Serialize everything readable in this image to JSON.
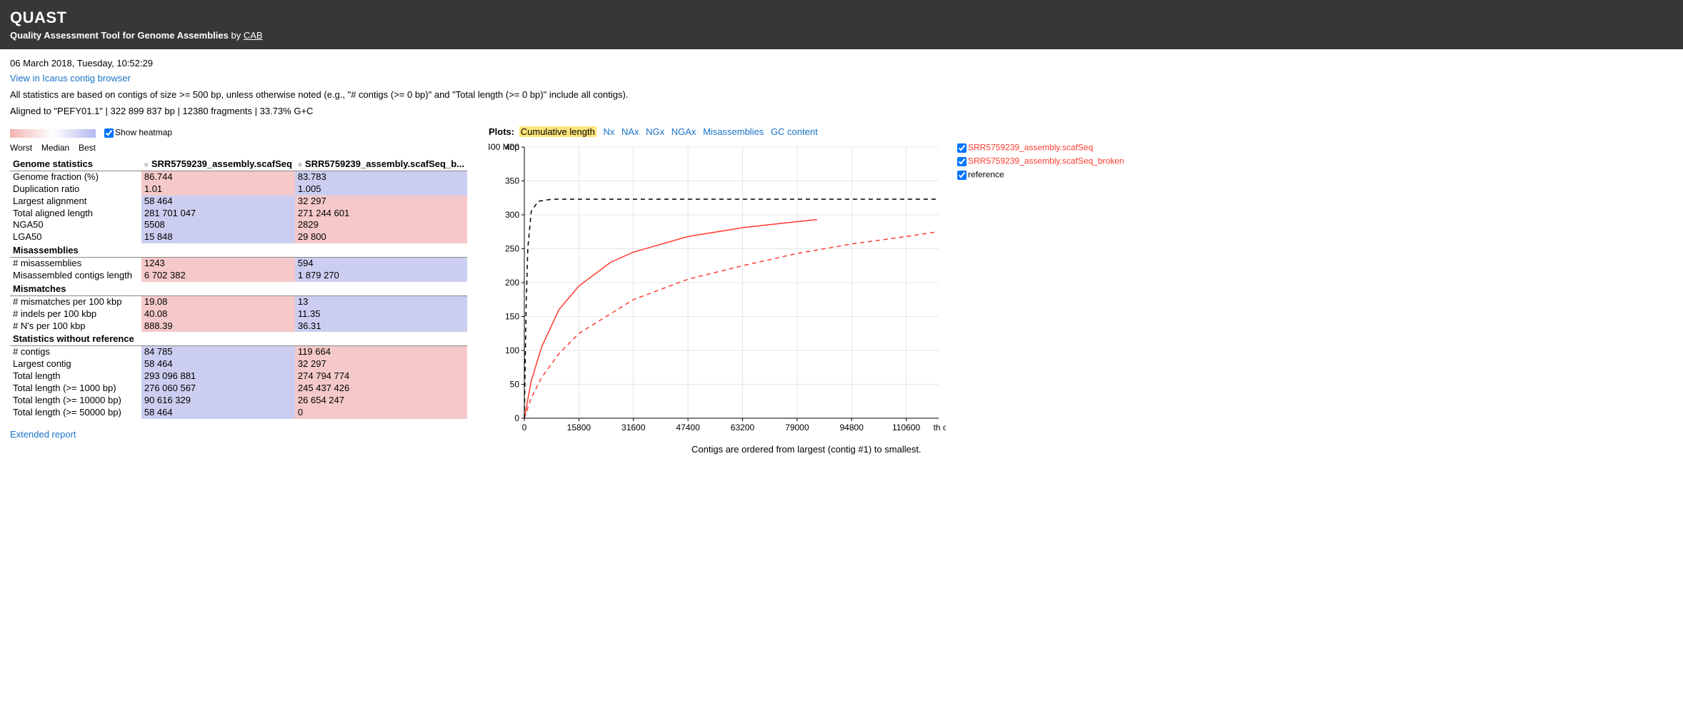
{
  "header": {
    "title": "QUAST",
    "subtitle_prefix": "Quality Assessment Tool for Genome Assemblies",
    "by": "by",
    "cab": "CAB"
  },
  "timestamp": "06 March 2018, Tuesday, 10:52:29",
  "icarus_link": "View in Icarus contig browser",
  "note": "All statistics are based on contigs of size >= 500 bp, unless otherwise noted (e.g., \"# contigs (>= 0 bp)\" and \"Total length (>= 0 bp)\" include all contigs).",
  "aligned": "Aligned to \"PEFY01.1\" | 322 899 837 bp | 12380 fragments | 33.73% G+C",
  "heatmap": {
    "worst": "Worst",
    "median": "Median",
    "best": "Best",
    "show": "Show heatmap"
  },
  "columns": {
    "c0": "Genome statistics",
    "c1": "SRR5759239_assembly.scafSeq",
    "c2": "SRR5759239_assembly.scafSeq_b..."
  },
  "sections": {
    "genome_stats": "Genome statistics",
    "misassemblies": "Misassemblies",
    "mismatches": "Mismatches",
    "no_ref": "Statistics without reference"
  },
  "rows": {
    "genome_fraction": {
      "label": "Genome fraction (%)",
      "v1": "86.744",
      "v2": "83.783",
      "hm1": "worst",
      "hm2": "best"
    },
    "dup_ratio": {
      "label": "Duplication ratio",
      "v1": "1.01",
      "v2": "1.005",
      "hm1": "worst",
      "hm2": "best"
    },
    "largest_alignment": {
      "label": "Largest alignment",
      "v1": "58 464",
      "v2": "32 297",
      "hm1": "best",
      "hm2": "worst"
    },
    "total_aligned": {
      "label": "Total aligned length",
      "v1": "281 701 047",
      "v2": "271 244 601",
      "hm1": "best",
      "hm2": "worst"
    },
    "nga50": {
      "label": "NGA50",
      "v1": "5508",
      "v2": "2829",
      "hm1": "best",
      "hm2": "worst"
    },
    "lga50": {
      "label": "LGA50",
      "v1": "15 848",
      "v2": "29 800",
      "hm1": "best",
      "hm2": "worst"
    },
    "n_misassemblies": {
      "label": "# misassemblies",
      "v1": "1243",
      "v2": "594",
      "hm1": "worst",
      "hm2": "best"
    },
    "misassembled_len": {
      "label": "Misassembled contigs length",
      "v1": "6 702 382",
      "v2": "1 879 270",
      "hm1": "worst",
      "hm2": "best"
    },
    "mismatches_100k": {
      "label": "# mismatches per 100 kbp",
      "v1": "19.08",
      "v2": "13",
      "hm1": "worst",
      "hm2": "best"
    },
    "indels_100k": {
      "label": "# indels per 100 kbp",
      "v1": "40.08",
      "v2": "11.35",
      "hm1": "worst",
      "hm2": "best"
    },
    "ns_100k": {
      "label": "# N's per 100 kbp",
      "v1": "888.39",
      "v2": "36.31",
      "hm1": "worst",
      "hm2": "best"
    },
    "n_contigs": {
      "label": "# contigs",
      "v1": "84 785",
      "v2": "119 664",
      "hm1": "best",
      "hm2": "worst"
    },
    "largest_contig": {
      "label": "Largest contig",
      "v1": "58 464",
      "v2": "32 297",
      "hm1": "best",
      "hm2": "worst"
    },
    "total_len": {
      "label": "Total length",
      "v1": "293 096 881",
      "v2": "274 794 774",
      "hm1": "best",
      "hm2": "worst"
    },
    "total_len_1000": {
      "label": "Total length (>= 1000 bp)",
      "v1": "276 060 567",
      "v2": "245 437 426",
      "hm1": "best",
      "hm2": "worst"
    },
    "total_len_10000": {
      "label": "Total length (>= 10000 bp)",
      "v1": "90 616 329",
      "v2": "26 654 247",
      "hm1": "best",
      "hm2": "worst"
    },
    "total_len_50000": {
      "label": "Total length (>= 50000 bp)",
      "v1": "58 464",
      "v2": "0",
      "hm1": "best",
      "hm2": "worst"
    }
  },
  "extended_report": "Extended report",
  "plot": {
    "tabs_label": "Plots:",
    "tabs": {
      "cumlen": "Cumulative length",
      "nx": "Nx",
      "nax": "NAx",
      "ngx": "NGx",
      "ngax": "NGAx",
      "mis": "Misassemblies",
      "gc": "GC content"
    },
    "y_unit": "Mbp",
    "caption": "Contigs are ordered from largest (contig #1) to smallest.",
    "legend": {
      "a": "SRR5759239_assembly.scafSeq",
      "b": "SRR5759239_assembly.scafSeq_broken",
      "ref": "reference"
    }
  },
  "chart_data": {
    "type": "line",
    "title": "Cumulative length",
    "xlabel": "th contig",
    "ylabel": "Mbp",
    "xlim": [
      0,
      120000
    ],
    "ylim": [
      0,
      400
    ],
    "x_ticks": [
      0,
      15800,
      31600,
      47400,
      63200,
      79000,
      94800,
      110600
    ],
    "y_ticks": [
      0,
      50,
      100,
      150,
      200,
      250,
      300,
      350,
      400
    ],
    "series": [
      {
        "name": "SRR5759239_assembly.scafSeq",
        "style": "solid",
        "color": "#ff3b2f",
        "x": [
          0,
          2000,
          5000,
          10000,
          15800,
          25000,
          31600,
          47400,
          63200,
          79000,
          84785
        ],
        "values": [
          0,
          55,
          105,
          160,
          195,
          230,
          245,
          268,
          281,
          290,
          293
        ]
      },
      {
        "name": "SRR5759239_assembly.scafSeq_broken",
        "style": "dashed",
        "color": "#ff3b2f",
        "x": [
          0,
          2000,
          5000,
          10000,
          15800,
          31600,
          47400,
          63200,
          79000,
          94800,
          110600,
          119664
        ],
        "values": [
          0,
          30,
          60,
          95,
          125,
          175,
          205,
          225,
          243,
          257,
          268,
          275
        ]
      },
      {
        "name": "reference",
        "style": "dashed",
        "color": "#000000",
        "x": [
          0,
          500,
          1000,
          2000,
          4000,
          8000,
          119664
        ],
        "values": [
          0,
          160,
          250,
          305,
          320,
          323,
          323
        ]
      }
    ]
  }
}
